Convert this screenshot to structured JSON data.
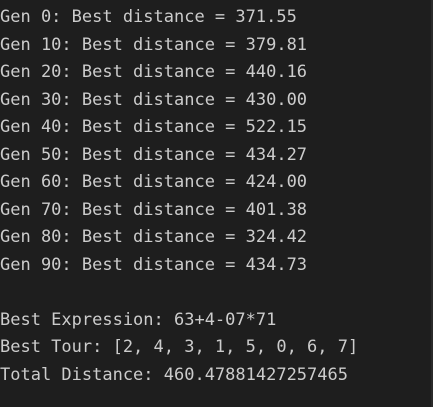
{
  "terminal": {
    "generation_lines": [
      "Gen 0: Best distance = 371.55",
      "Gen 10: Best distance = 379.81",
      "Gen 20: Best distance = 440.16",
      "Gen 30: Best distance = 430.00",
      "Gen 40: Best distance = 522.15",
      "Gen 50: Best distance = 434.27",
      "Gen 60: Best distance = 424.00",
      "Gen 70: Best distance = 401.38",
      "Gen 80: Best distance = 324.42",
      "Gen 90: Best distance = 434.73"
    ],
    "summary": {
      "best_expression": "Best Expression: 63+4-07*71",
      "best_tour": "Best Tour: [2, 4, 3, 1, 5, 0, 6, 7]",
      "total_distance": "Total Distance: 460.47881427257465"
    },
    "colors": {
      "background": "#1e1e1e",
      "text": "#cccccc"
    }
  }
}
